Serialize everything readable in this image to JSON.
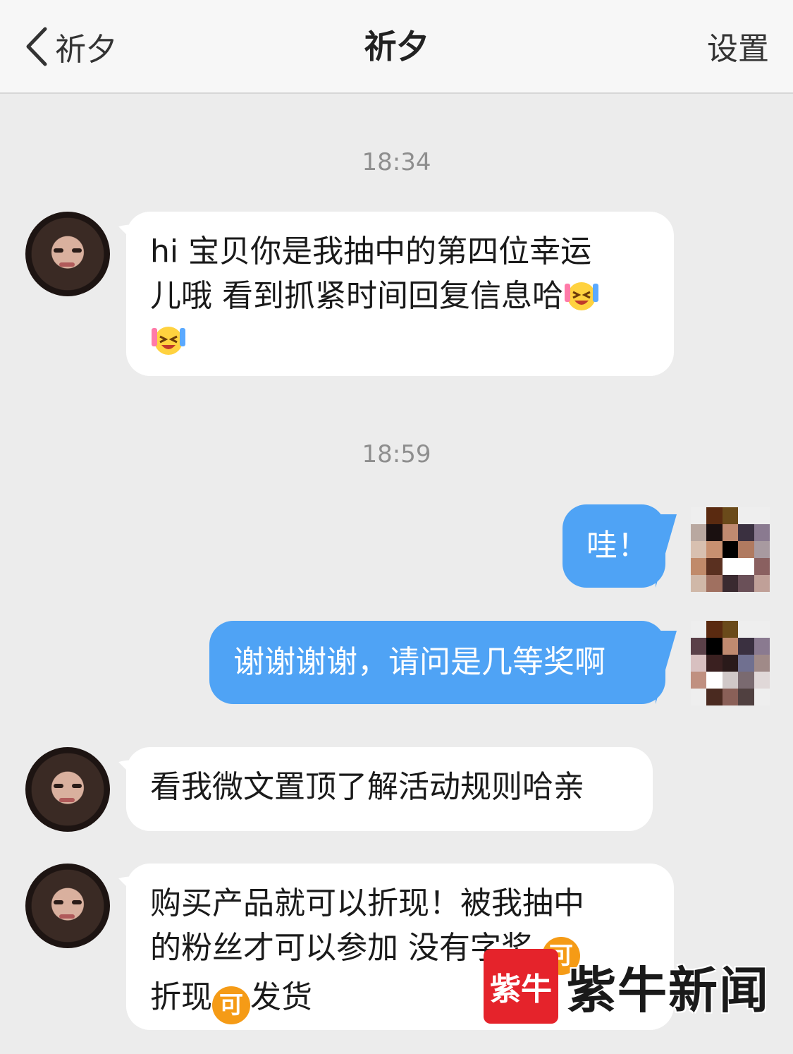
{
  "header": {
    "back_label": "祈夕",
    "title": "祈夕",
    "settings_label": "设置"
  },
  "timestamps": [
    "18:34",
    "18:59"
  ],
  "messages": [
    {
      "side": "left",
      "lines": [
        "hi 宝贝你是我抽中的第四位幸运",
        "儿哦 看到抓紧时间回复信息哈"
      ],
      "emoji": "laughing-crying-emoji"
    },
    {
      "side": "right",
      "text": "哇！"
    },
    {
      "side": "right",
      "text": "谢谢谢谢，请问是几等奖啊"
    },
    {
      "side": "left",
      "text": "看我微文置顶了解活动规则哈亲"
    },
    {
      "side": "left",
      "lines": [
        "购买产品就可以折现！被我抽中",
        "的粉丝才可以参加 没有字奖",
        "折现",
        "发货"
      ],
      "coin_label": "可"
    }
  ],
  "watermark": {
    "logo_text": "紫牛",
    "brand_text": "紫牛新闻"
  },
  "colors": {
    "accent_bubble": "#4fa3f5",
    "background": "#ececec",
    "coin": "#f59b16",
    "watermark_red": "#e5232b"
  }
}
